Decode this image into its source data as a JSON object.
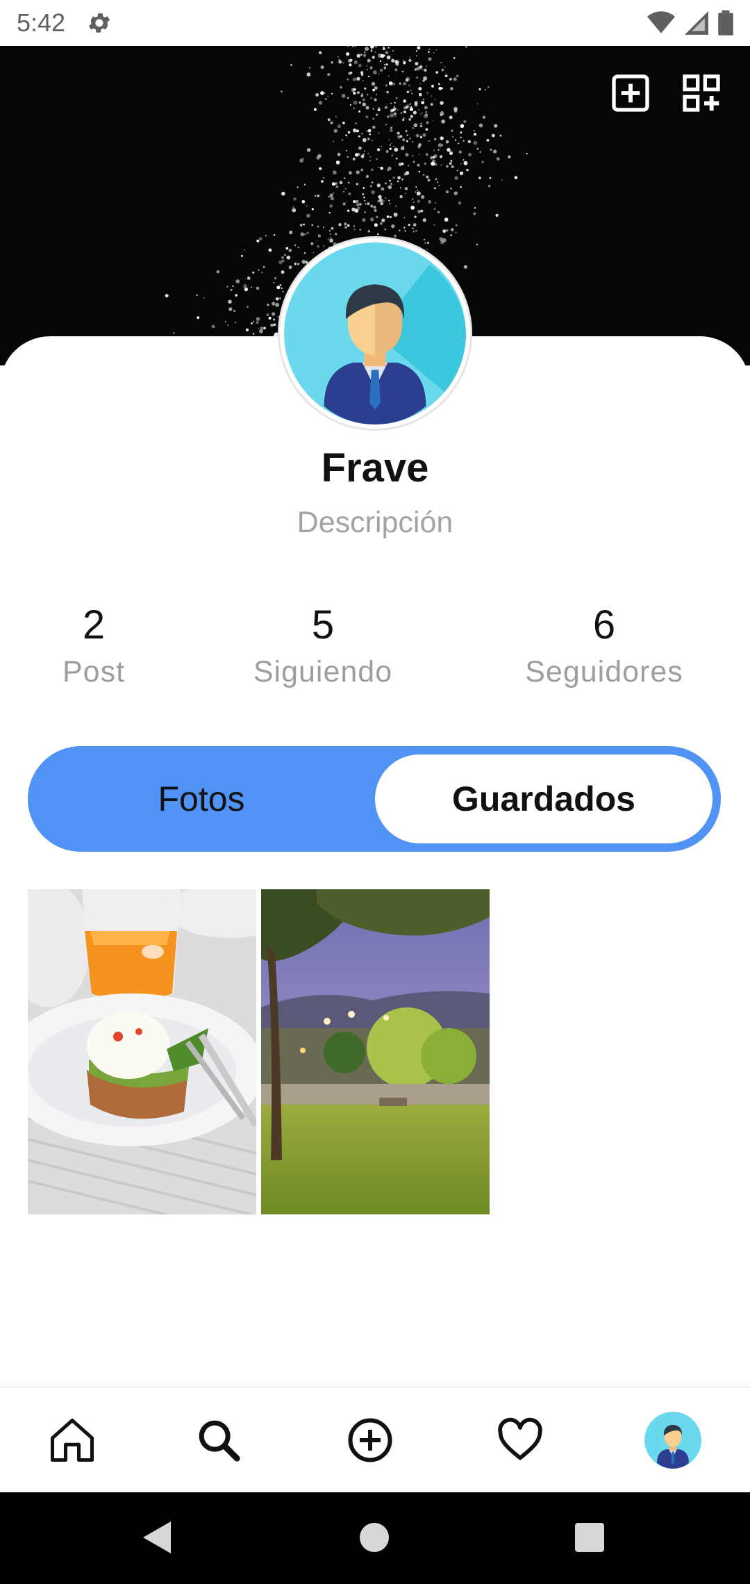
{
  "status_bar": {
    "time": "5:42",
    "settings_icon": "gear-icon",
    "icons": [
      "wifi-icon",
      "signal-icon",
      "battery-icon"
    ]
  },
  "header": {
    "actions": [
      {
        "name": "add-post-button",
        "icon": "plus-square-icon"
      },
      {
        "name": "qr-add-button",
        "icon": "qr-grid-plus-icon"
      }
    ]
  },
  "profile": {
    "name": "Frave",
    "description": "Descripción"
  },
  "stats": [
    {
      "value": "2",
      "label": "Post"
    },
    {
      "value": "5",
      "label": "Siguiendo"
    },
    {
      "value": "6",
      "label": "Seguidores"
    }
  ],
  "tabs": {
    "photos_label": "Fotos",
    "saved_label": "Guardados",
    "selected": "Guardados"
  },
  "grid": [
    {
      "subject": "breakfast-photo"
    },
    {
      "subject": "park-photo"
    }
  ],
  "bottom_nav": [
    "home-icon",
    "search-icon",
    "plus-circle-icon",
    "heart-icon",
    "profile-avatar"
  ],
  "colors": {
    "accent": "#5093f5",
    "cover": "#060606",
    "text": "#111111",
    "muted": "#9e9e9e"
  }
}
